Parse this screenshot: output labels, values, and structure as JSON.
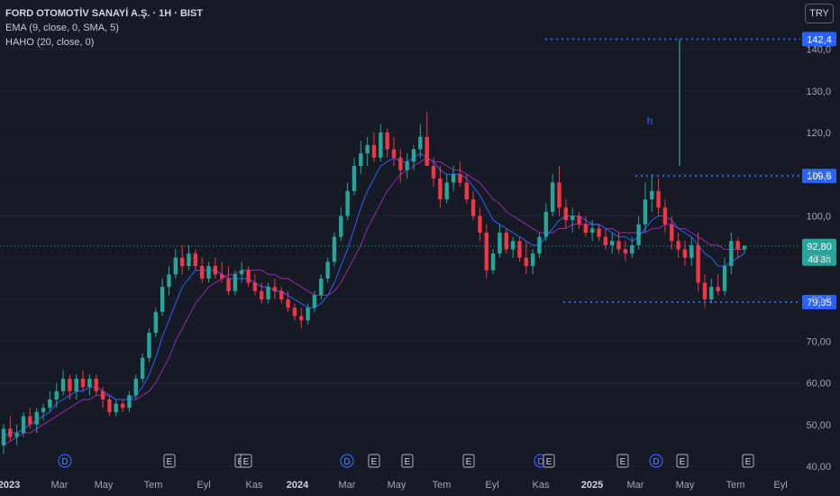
{
  "header": {
    "symbol_line": "FORD OTOMOTİV SANAYİ A.Ş. · 1H · BIST",
    "indicator_1": "EMA (9, close, 0, SMA, 5)",
    "indicator_2": "HAHO (20, close, 0)"
  },
  "currency_button": "TRY",
  "chart_data": {
    "type": "candlestick",
    "y_axis": {
      "min": 40,
      "max": 145,
      "ticks": [
        "40,00",
        "50,00",
        "60,00",
        "70,00",
        "80,0",
        "90,0",
        "100,0",
        "110,0",
        "120,0",
        "130,0",
        "140,0"
      ],
      "tick_values": [
        40,
        50,
        60,
        70,
        80,
        90,
        100,
        110,
        120,
        130,
        140
      ]
    },
    "x_axis": {
      "labels": [
        "2023",
        "Mar",
        "May",
        "Tem",
        "Eyl",
        "Kas",
        "2024",
        "Mar",
        "May",
        "Tem",
        "Eyl",
        "Kas",
        "2025",
        "Mar",
        "May",
        "Tem",
        "Eyl"
      ],
      "bold": [
        "2023",
        "2024",
        "2025"
      ]
    },
    "candles": [
      [
        45,
        50,
        43,
        49
      ],
      [
        49,
        52,
        46,
        47
      ],
      [
        47,
        50,
        45,
        48
      ],
      [
        48,
        53,
        47,
        52
      ],
      [
        52,
        54,
        49,
        50
      ],
      [
        50,
        54,
        48,
        53
      ],
      [
        53,
        55,
        51,
        54
      ],
      [
        54,
        58,
        53,
        56
      ],
      [
        56,
        60,
        54,
        58
      ],
      [
        58,
        63,
        57,
        61
      ],
      [
        61,
        62,
        56,
        58
      ],
      [
        58,
        62,
        56,
        61
      ],
      [
        61,
        63,
        58,
        59
      ],
      [
        59,
        62,
        57,
        61
      ],
      [
        61,
        62,
        57,
        58
      ],
      [
        58,
        59,
        54,
        56
      ],
      [
        56,
        57,
        52,
        53
      ],
      [
        53,
        56,
        52,
        55
      ],
      [
        55,
        56,
        53,
        54
      ],
      [
        54,
        58,
        53,
        57
      ],
      [
        57,
        62,
        56,
        61
      ],
      [
        61,
        67,
        60,
        66
      ],
      [
        66,
        73,
        65,
        72
      ],
      [
        72,
        78,
        71,
        77
      ],
      [
        77,
        85,
        76,
        83
      ],
      [
        83,
        88,
        81,
        86
      ],
      [
        86,
        92,
        85,
        90
      ],
      [
        90,
        93,
        86,
        88
      ],
      [
        88,
        93,
        87,
        91
      ],
      [
        91,
        92,
        87,
        88
      ],
      [
        88,
        90,
        84,
        85
      ],
      [
        85,
        89,
        84,
        88
      ],
      [
        88,
        90,
        85,
        86
      ],
      [
        86,
        89,
        84,
        85
      ],
      [
        85,
        88,
        81,
        82
      ],
      [
        82,
        87,
        81,
        86
      ],
      [
        86,
        89,
        84,
        87
      ],
      [
        87,
        88,
        83,
        84
      ],
      [
        84,
        86,
        81,
        82
      ],
      [
        82,
        84,
        79,
        80
      ],
      [
        80,
        84,
        79,
        83
      ],
      [
        83,
        85,
        80,
        82
      ],
      [
        82,
        83,
        79,
        80
      ],
      [
        80,
        82,
        77,
        78
      ],
      [
        78,
        79,
        75,
        76
      ],
      [
        76,
        78,
        73,
        75
      ],
      [
        75,
        79,
        74,
        78
      ],
      [
        78,
        82,
        77,
        81
      ],
      [
        81,
        86,
        80,
        85
      ],
      [
        85,
        90,
        84,
        89
      ],
      [
        89,
        96,
        88,
        95
      ],
      [
        95,
        102,
        94,
        100
      ],
      [
        100,
        108,
        99,
        106
      ],
      [
        106,
        114,
        105,
        112
      ],
      [
        112,
        118,
        110,
        115
      ],
      [
        115,
        119,
        112,
        117
      ],
      [
        117,
        120,
        113,
        114
      ],
      [
        114,
        122,
        113,
        120
      ],
      [
        120,
        121,
        114,
        116
      ],
      [
        116,
        119,
        112,
        114
      ],
      [
        114,
        116,
        108,
        111
      ],
      [
        111,
        115,
        109,
        113
      ],
      [
        113,
        117,
        111,
        116
      ],
      [
        116,
        122,
        114,
        119
      ],
      [
        119,
        125,
        117,
        112
      ],
      [
        112,
        114,
        107,
        109
      ],
      [
        109,
        112,
        102,
        104
      ],
      [
        104,
        110,
        103,
        108
      ],
      [
        108,
        112,
        106,
        110
      ],
      [
        110,
        113,
        107,
        108
      ],
      [
        108,
        110,
        103,
        104
      ],
      [
        104,
        106,
        99,
        100
      ],
      [
        100,
        102,
        94,
        96
      ],
      [
        96,
        98,
        85,
        87
      ],
      [
        87,
        92,
        86,
        91
      ],
      [
        91,
        98,
        90,
        96
      ],
      [
        96,
        97,
        91,
        92
      ],
      [
        92,
        95,
        90,
        94
      ],
      [
        94,
        95,
        89,
        90
      ],
      [
        90,
        94,
        86,
        88
      ],
      [
        88,
        92,
        86,
        91
      ],
      [
        91,
        96,
        90,
        95
      ],
      [
        95,
        103,
        94,
        101
      ],
      [
        101,
        110,
        100,
        108
      ],
      [
        108,
        112,
        100,
        102
      ],
      [
        102,
        104,
        97,
        99
      ],
      [
        99,
        102,
        96,
        100
      ],
      [
        100,
        101,
        97,
        98
      ],
      [
        98,
        100,
        95,
        96
      ],
      [
        96,
        99,
        94,
        97
      ],
      [
        97,
        98,
        94,
        95
      ],
      [
        95,
        97,
        92,
        93
      ],
      [
        93,
        96,
        91,
        94
      ],
      [
        94,
        96,
        91,
        92
      ],
      [
        92,
        94,
        89,
        91
      ],
      [
        91,
        95,
        90,
        93
      ],
      [
        93,
        100,
        92,
        98
      ],
      [
        98,
        108,
        96,
        104
      ],
      [
        104,
        110,
        101,
        106
      ],
      [
        106,
        109,
        100,
        102
      ],
      [
        102,
        104,
        96,
        98
      ],
      [
        98,
        100,
        92,
        94
      ],
      [
        94,
        96,
        90,
        92
      ],
      [
        92,
        94,
        88,
        90
      ],
      [
        90,
        95,
        88,
        93
      ],
      [
        93,
        96,
        82,
        84
      ],
      [
        84,
        86,
        78,
        80
      ],
      [
        80,
        85,
        79,
        83
      ],
      [
        83,
        86,
        81,
        82
      ],
      [
        82,
        90,
        81,
        88
      ],
      [
        88,
        96,
        86,
        94
      ],
      [
        94,
        95,
        90,
        92
      ],
      [
        92,
        93,
        91,
        92.8
      ]
    ],
    "ema_line": [
      47,
      48,
      48,
      49,
      50,
      51,
      52,
      53,
      55,
      56,
      57,
      58,
      58,
      59,
      59,
      58,
      57,
      56,
      56,
      56,
      57,
      59,
      62,
      66,
      71,
      75,
      79,
      83,
      85,
      87,
      87,
      87,
      87,
      86,
      85,
      85,
      85,
      85,
      84,
      83,
      83,
      82,
      82,
      81,
      80,
      79,
      78,
      78,
      79,
      81,
      84,
      88,
      92,
      97,
      102,
      106,
      109,
      112,
      113,
      114,
      113,
      113,
      114,
      115,
      114,
      113,
      111,
      110,
      110,
      110,
      109,
      107,
      105,
      102,
      99,
      98,
      97,
      96,
      95,
      94,
      93,
      93,
      95,
      97,
      99,
      100,
      100,
      100,
      99,
      98,
      98,
      97,
      96,
      95,
      95,
      94,
      95,
      97,
      99,
      100,
      100,
      99,
      97,
      96,
      95,
      93,
      91,
      90,
      88,
      88,
      89,
      90,
      91
    ],
    "haho_line": [
      45,
      46,
      47,
      48,
      48,
      49,
      50,
      51,
      52,
      53,
      54,
      55,
      56,
      56,
      57,
      57,
      57,
      56,
      56,
      56,
      56,
      57,
      58,
      60,
      63,
      66,
      70,
      73,
      76,
      79,
      81,
      83,
      84,
      85,
      86,
      86,
      87,
      87,
      87,
      87,
      86,
      86,
      85,
      85,
      84,
      83,
      82,
      81,
      81,
      81,
      82,
      84,
      87,
      90,
      93,
      97,
      100,
      103,
      106,
      108,
      110,
      111,
      112,
      113,
      114,
      113,
      113,
      112,
      111,
      111,
      110,
      109,
      108,
      106,
      104,
      103,
      101,
      100,
      99,
      98,
      97,
      96,
      96,
      96,
      97,
      97,
      98,
      98,
      98,
      98,
      98,
      97,
      97,
      96,
      96,
      96,
      96,
      96,
      97,
      97,
      98,
      98,
      97,
      97,
      96,
      95,
      94,
      93,
      93,
      92,
      92,
      92,
      92
    ],
    "price_levels": [
      {
        "label": "142,4",
        "value": 142.4,
        "style": "dotted",
        "color": "#2962ff"
      },
      {
        "label": "109,6",
        "value": 109.6,
        "style": "dotted",
        "color": "#2962ff"
      },
      {
        "label": "79,35",
        "value": 79.35,
        "style": "dotted",
        "color": "#2962ff"
      }
    ],
    "current_price": {
      "label": "92,80",
      "countdown": "4d 3h",
      "value": 92.8
    },
    "annotations": [
      {
        "text": "h",
        "color": "#2962ff"
      },
      {
        "text": "h",
        "color": "#131722"
      }
    ],
    "measure_line": {
      "from": 112,
      "to": 142.4,
      "color": "#26a69a"
    },
    "event_markers": [
      {
        "letter": "D",
        "type": "dividend"
      },
      {
        "letter": "E",
        "type": "earnings"
      },
      {
        "letter": "E",
        "type": "earnings"
      },
      {
        "letter": "E",
        "type": "earnings"
      },
      {
        "letter": "D",
        "type": "dividend"
      },
      {
        "letter": "E",
        "type": "earnings"
      },
      {
        "letter": "E",
        "type": "earnings"
      },
      {
        "letter": "E",
        "type": "earnings"
      },
      {
        "letter": "D",
        "type": "dividend"
      },
      {
        "letter": "E",
        "type": "earnings"
      },
      {
        "letter": "E",
        "type": "earnings"
      },
      {
        "letter": "D",
        "type": "dividend"
      },
      {
        "letter": "E",
        "type": "earnings"
      },
      {
        "letter": "E",
        "type": "earnings"
      }
    ],
    "colors": {
      "up": "#26a69a",
      "down": "#f23645",
      "ema": "#2962ff",
      "haho": "#9c27b0",
      "background": "#161a25"
    }
  }
}
